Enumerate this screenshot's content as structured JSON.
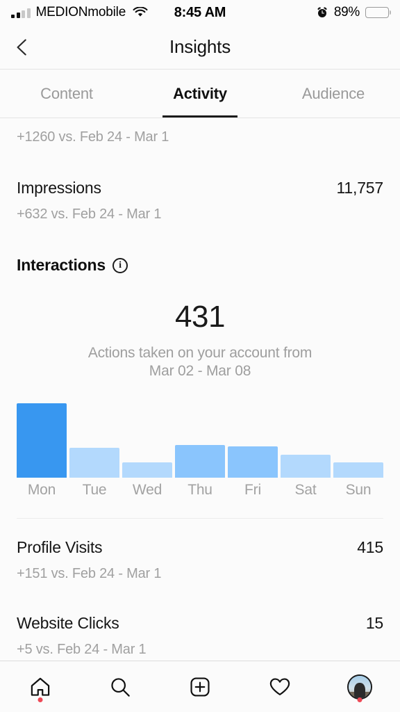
{
  "status_bar": {
    "carrier": "MEDIONmobile",
    "signal_bars_filled": 2,
    "signal_bars_total": 4,
    "wifi_icon": "wifi-icon",
    "time": "8:45 AM",
    "alarm_icon": "alarm-clock-icon",
    "battery_percent": "89%",
    "battery_level": 89
  },
  "navbar": {
    "back_icon": "chevron-left-icon",
    "title": "Insights"
  },
  "tabs": [
    {
      "label": "Content",
      "active": false
    },
    {
      "label": "Activity",
      "active": true
    },
    {
      "label": "Audience",
      "active": false
    }
  ],
  "metrics_top": [
    {
      "name": "",
      "value": "",
      "sub": "+1260 vs. Feb 24 - Mar 1"
    },
    {
      "name": "Impressions",
      "value": "11,757",
      "sub": "+632 vs. Feb 24 - Mar 1"
    }
  ],
  "interactions": {
    "section_title": "Interactions",
    "info_icon": "info-circle-icon",
    "info_glyph": "i",
    "total": "431",
    "caption_line1": "Actions taken on your account from",
    "caption_line2": "Mar 02 - Mar 08"
  },
  "metrics_bottom": [
    {
      "name": "Profile Visits",
      "value": "415",
      "sub": "+151 vs. Feb 24 - Mar 1"
    },
    {
      "name": "Website Clicks",
      "value": "15",
      "sub": "+5 vs. Feb 24 - Mar 1"
    }
  ],
  "tabbar": [
    {
      "name": "home-icon",
      "badge": true
    },
    {
      "name": "search-icon",
      "badge": false
    },
    {
      "name": "add-post-icon",
      "badge": false
    },
    {
      "name": "heart-icon",
      "badge": false
    },
    {
      "name": "profile-avatar",
      "badge": true
    }
  ],
  "colors": {
    "bar_selected": "#3897f0",
    "bar_medium": "#8ac5fd",
    "bar_light": "#b3d9fd",
    "accent_badge": "#ed4956",
    "background": "#fbfbfb",
    "text_primary": "#151515",
    "text_muted": "#a0a0a0"
  },
  "chart_data": {
    "type": "bar",
    "title": "Interactions by day",
    "categories": [
      "Mon",
      "Tue",
      "Wed",
      "Thu",
      "Fri",
      "Sat",
      "Sun"
    ],
    "values": [
      107,
      43,
      22,
      47,
      45,
      33,
      22
    ],
    "bar_colors": [
      "#3897f0",
      "#b3d9fd",
      "#b3d9fd",
      "#8ac5fd",
      "#8ac5fd",
      "#b3d9fd",
      "#b3d9fd"
    ],
    "selected_index": 0,
    "xlabel": "",
    "ylabel": "",
    "ylim": [
      0,
      107
    ],
    "grid": false,
    "legend": false,
    "value_labels": false
  }
}
